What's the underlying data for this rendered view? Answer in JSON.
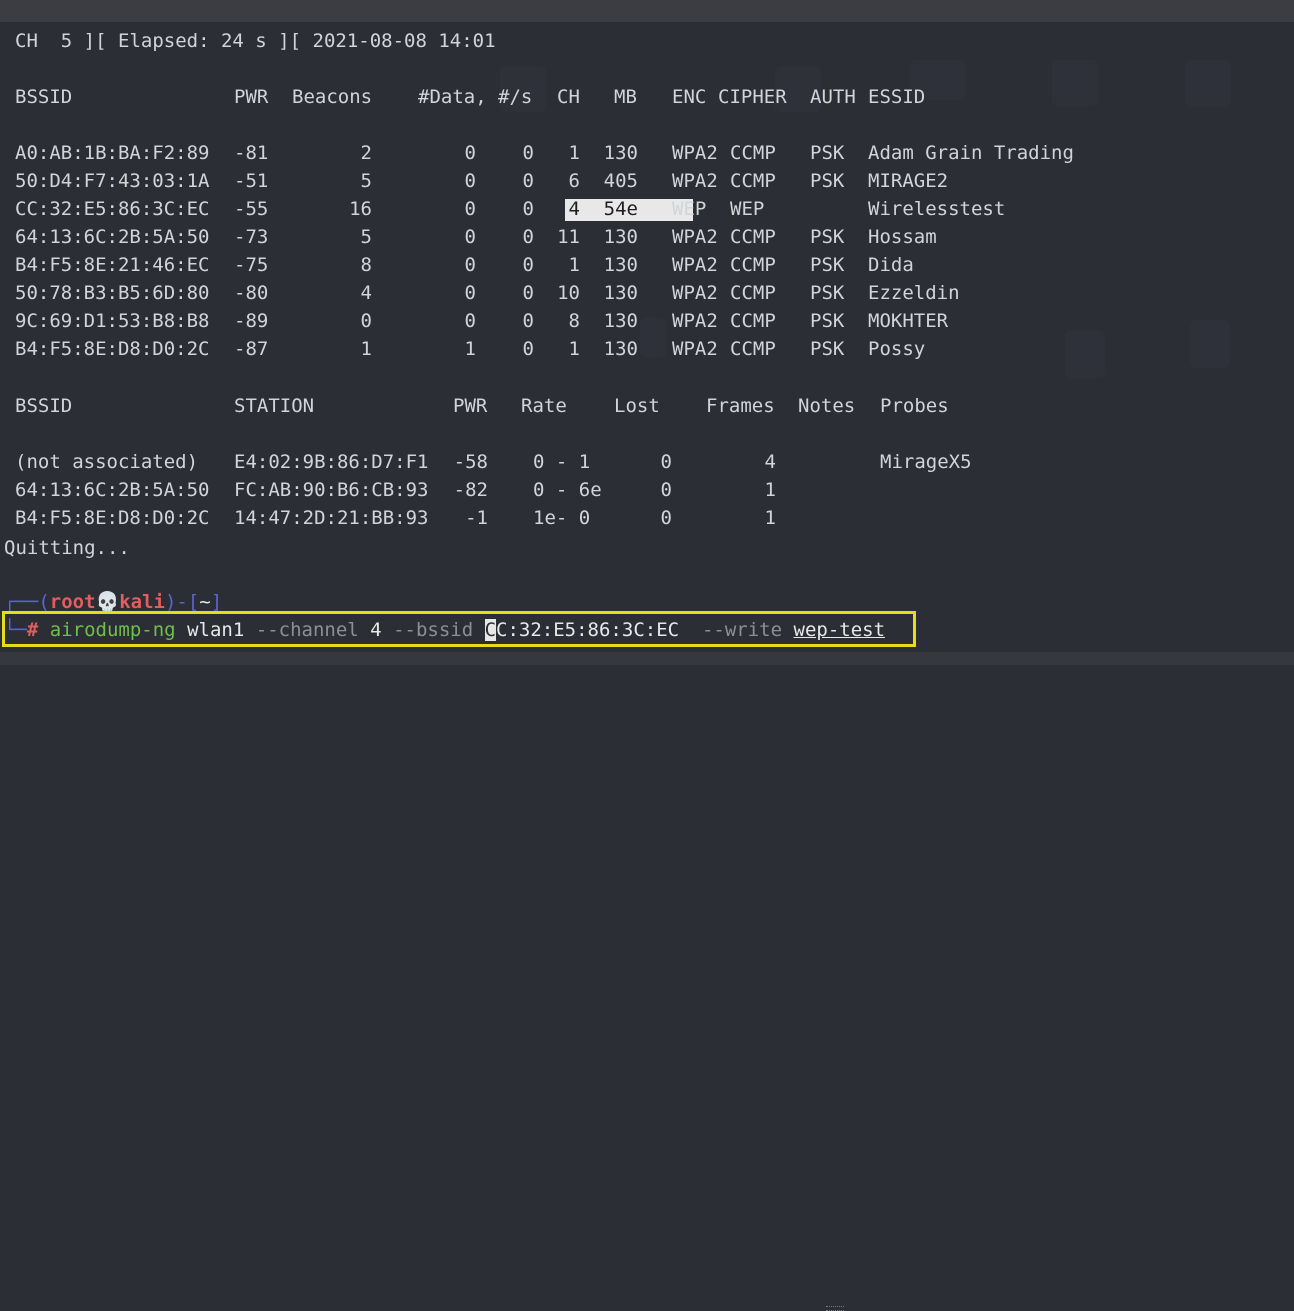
{
  "header": {
    "ch_label": "CH",
    "ch_value": "5",
    "elapsed_label": "Elapsed:",
    "elapsed_value": "24 s",
    "datetime": "2021-08-08 14:01"
  },
  "ap_table": {
    "headers": [
      "BSSID",
      "PWR",
      "Beacons",
      "#Data,",
      "#/s",
      "CH",
      "MB",
      "ENC",
      "CIPHER",
      "AUTH",
      "ESSID"
    ],
    "rows": [
      {
        "bssid": "A0:AB:1B:BA:F2:89",
        "pwr": "-81",
        "beacons": "2",
        "data": "0",
        "per_s": "0",
        "ch": "1",
        "mb": "130",
        "enc": "WPA2",
        "cipher": "CCMP",
        "auth": "PSK",
        "essid": "Adam Grain Trading"
      },
      {
        "bssid": "50:D4:F7:43:03:1A",
        "pwr": "-51",
        "beacons": "5",
        "data": "0",
        "per_s": "0",
        "ch": "6",
        "mb": "405",
        "enc": "WPA2",
        "cipher": "CCMP",
        "auth": "PSK",
        "essid": "MIRAGE2"
      },
      {
        "bssid": "CC:32:E5:86:3C:EC",
        "pwr": "-55",
        "beacons": "16",
        "data": "0",
        "per_s": "0",
        "ch": "4",
        "mb": "54e",
        "enc": "WEP",
        "cipher": "WEP",
        "auth": "",
        "essid": "Wirelesstest"
      },
      {
        "bssid": "64:13:6C:2B:5A:50",
        "pwr": "-73",
        "beacons": "5",
        "data": "0",
        "per_s": "0",
        "ch": "11",
        "mb": "130",
        "enc": "WPA2",
        "cipher": "CCMP",
        "auth": "PSK",
        "essid": "Hossam"
      },
      {
        "bssid": "B4:F5:8E:21:46:EC",
        "pwr": "-75",
        "beacons": "8",
        "data": "0",
        "per_s": "0",
        "ch": "1",
        "mb": "130",
        "enc": "WPA2",
        "cipher": "CCMP",
        "auth": "PSK",
        "essid": "Dida"
      },
      {
        "bssid": "50:78:B3:B5:6D:80",
        "pwr": "-80",
        "beacons": "4",
        "data": "0",
        "per_s": "0",
        "ch": "10",
        "mb": "130",
        "enc": "WPA2",
        "cipher": "CCMP",
        "auth": "PSK",
        "essid": "Ezzeldin"
      },
      {
        "bssid": "9C:69:D1:53:B8:B8",
        "pwr": "-89",
        "beacons": "0",
        "data": "0",
        "per_s": "0",
        "ch": "8",
        "mb": "130",
        "enc": "WPA2",
        "cipher": "CCMP",
        "auth": "PSK",
        "essid": "MOKHTER"
      },
      {
        "bssid": "B4:F5:8E:D8:D0:2C",
        "pwr": "-87",
        "beacons": "1",
        "data": "1",
        "per_s": "0",
        "ch": "1",
        "mb": "130",
        "enc": "WPA2",
        "cipher": "CCMP",
        "auth": "PSK",
        "essid": "Possy"
      }
    ]
  },
  "station_table": {
    "headers": [
      "BSSID",
      "STATION",
      "PWR",
      "Rate",
      "Lost",
      "Frames",
      "Notes",
      "Probes"
    ],
    "rows": [
      {
        "bssid": "(not associated)",
        "station": "E4:02:9B:86:D7:F1",
        "pwr": "-58",
        "rate": "0 - 1",
        "lost": "0",
        "frames": "4",
        "notes": "",
        "probes": "MirageX5"
      },
      {
        "bssid": "64:13:6C:2B:5A:50",
        "station": "FC:AB:90:B6:CB:93",
        "pwr": "-82",
        "rate": "0 - 6e",
        "lost": "0",
        "frames": "1",
        "notes": "",
        "probes": ""
      },
      {
        "bssid": "B4:F5:8E:D8:D0:2C",
        "station": "14:47:2D:21:BB:93",
        "pwr": "-1",
        "rate": "1e- 0",
        "lost": "0",
        "frames": "1",
        "notes": "",
        "probes": ""
      }
    ]
  },
  "quit_message": "Quitting...",
  "prompt": {
    "user": "root",
    "host": "kali",
    "cwd": "~",
    "symbol": "#",
    "command": {
      "program": "airodump-ng",
      "interface": "wlan1",
      "channel_flag": "--channel",
      "channel_value": "4",
      "bssid_flag": "--bssid",
      "bssid_value": "CC:32:E5:86:3C:EC",
      "write_flag": "--write",
      "write_value": "wep-test"
    }
  },
  "colors": {
    "background": "#2b2e34",
    "text": "#d2d4d8",
    "prompt_frame": "#5a63d6",
    "prompt_user": "#e25d5d",
    "command_program": "#6fc04a",
    "command_flags": "#8d8f96",
    "highlight_box": "#e6dc1a"
  }
}
